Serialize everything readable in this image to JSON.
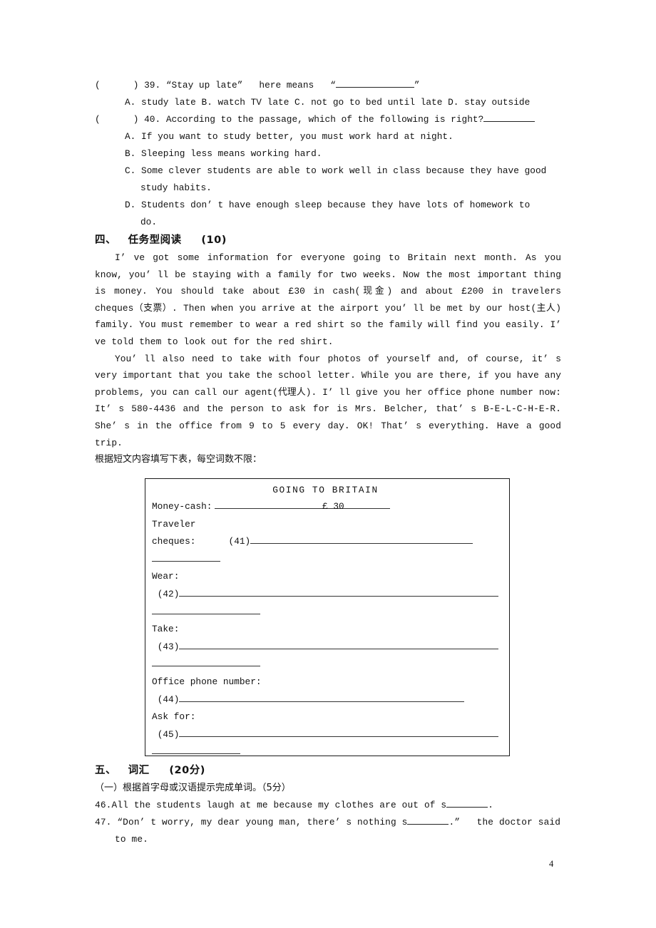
{
  "document": {
    "page_number": "4",
    "subject_hint": "English exam paper"
  },
  "multiple_choice": {
    "q39": {
      "bracket": "(      )",
      "number": "39.",
      "stem_before": "“Stay up late”   here means   “",
      "stem_after": "”",
      "options_line": "A. study late B. watch TV late C. not go to bed until late D. stay outside"
    },
    "q40": {
      "bracket": "(      )",
      "number": "40.",
      "stem": "According to the passage, which of the following is right?",
      "options": [
        "A. If you want to study better, you must work hard at night.",
        "B. Sleeping less means working hard.",
        "C. Some clever students are able to work well in class because they have good",
        "study habits.",
        "D. Students don’ t have enough sleep because they have lots of homework to",
        "do."
      ]
    }
  },
  "section_four": {
    "heading": "四、   任务型阅读     (10)",
    "passage_paragraph_1": "I’ ve got some information for everyone going to Britain next month. As you know, you’ ll be staying with a family for two weeks. Now the most important thing is money. You should take about  £30 in  cash(现金) and about  £200 in  travelers cheques（支票）. Then when you arrive at the airport you’ ll be met by our host(主人) family. You must remember to wear a red shirt so the family will find you easily. I’ ve told them to look out for the red shirt.",
    "passage_paragraph_2": "You’ ll also need to take with four photos of yourself and, of course, it’ s very important that you take the school letter. While you are there, if you have any problems, you can call our agent(代理人). I’ ll give you her office phone number now: It’ s 580-4436 and the person to ask for is Mrs. Belcher, that’ s B-E-L-C-H-E-R. She’ s in the office from 9 to 5 every day. OK! That’ s everything. Have a good trip.",
    "instruction": "根据短文内容填写下表，每空词数不限："
  },
  "britain_table": {
    "title": "GOING TO BRITAIN",
    "rows": [
      {
        "label": "Money-cash:",
        "value": "£ 30",
        "number": ""
      },
      {
        "label": "Traveler",
        "value": "",
        "number": ""
      },
      {
        "label": "cheques:",
        "value": "",
        "number": "(41)"
      },
      {
        "label": "Wear:",
        "value": "",
        "number": "(42)"
      },
      {
        "label": "Take:",
        "value": "",
        "number": "(43)"
      },
      {
        "label": "Office phone number:",
        "value": "",
        "number": "(44)"
      },
      {
        "label": "Ask for:",
        "value": "",
        "number": "(45)"
      }
    ]
  },
  "section_five": {
    "heading": "五、   词汇     (20分)",
    "subheading": "（一）根据首字母或汉语提示完成单词。（5分）",
    "items": [
      {
        "number": "46.",
        "text_before": "All the students laugh at me because my clothes are out of s",
        "text_after": "."
      },
      {
        "number": "47.",
        "text_before": "“Don’ t worry, my dear young man, there’ s nothing s",
        "text_after": ".”   the doctor said",
        "continuation": "to me."
      }
    ]
  }
}
